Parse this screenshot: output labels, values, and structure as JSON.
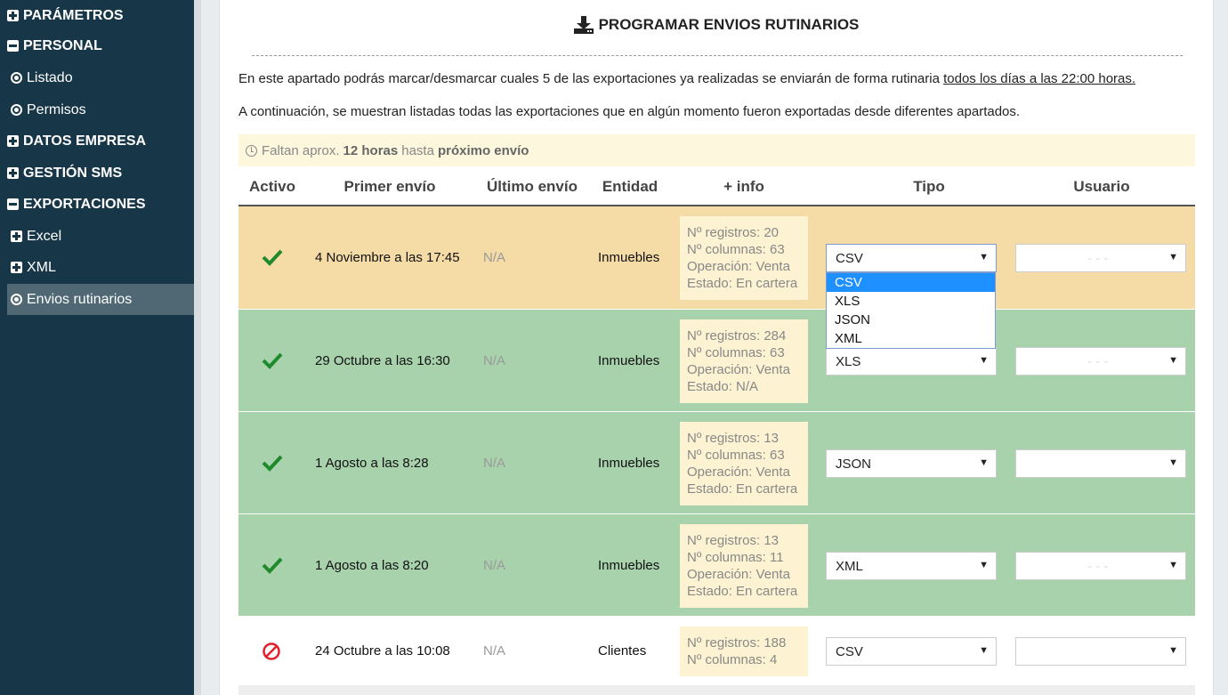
{
  "sidebar": {
    "items": [
      {
        "label": "PARÁMETROS",
        "kind": "top",
        "icon": "plus-square-icon"
      },
      {
        "label": "PERSONAL",
        "kind": "top",
        "icon": "minus-square-icon"
      },
      {
        "label": "Listado",
        "kind": "sub",
        "icon": "radio-dot-icon"
      },
      {
        "label": "Permisos",
        "kind": "sub",
        "icon": "radio-dot-icon"
      },
      {
        "label": "DATOS EMPRESA",
        "kind": "top",
        "icon": "plus-square-icon"
      },
      {
        "label": "GESTIÓN SMS",
        "kind": "top",
        "icon": "plus-square-icon"
      },
      {
        "label": "EXPORTACIONES",
        "kind": "top",
        "icon": "minus-square-icon"
      },
      {
        "label": "Excel",
        "kind": "sub",
        "icon": "plus-square-icon"
      },
      {
        "label": "XML",
        "kind": "sub",
        "icon": "plus-square-icon"
      },
      {
        "label": "Envios rutinarios",
        "kind": "sub",
        "icon": "radio-dot-icon",
        "active": true
      }
    ]
  },
  "page": {
    "title": "PROGRAMAR ENVIOS RUTINARIOS",
    "title_icon": "download-icon",
    "intro": "En este apartado podrás marcar/desmarcar cuales 5 de las exportaciones ya realizadas se enviarán de forma rutinaria",
    "intro_link": "todos los días a las 22:00 horas.",
    "intro2": "A continuación, se muestran listadas todas las exportaciones que en algún momento fueron exportadas desde diferentes apartados.",
    "notice": {
      "icon": "clock-icon",
      "prefix": "Faltan aprox.",
      "bold": "12 horas",
      "middle": "hasta",
      "bold2": "próximo envío"
    }
  },
  "table": {
    "headers": [
      "Activo",
      "Primer envío",
      "Último envío",
      "Entidad",
      "+ info",
      "Tipo",
      "Usuario"
    ],
    "rows": [
      {
        "active": true,
        "first": "4 Noviembre a las 17:45",
        "last": "N/A",
        "entity": "Inmuebles",
        "info": [
          "Nº registros: 20",
          "Nº columnas: 63",
          "Operación: Venta",
          "Estado: En cartera"
        ],
        "tipo": "CSV",
        "usuario": "- - -",
        "bg": "#f5dba6"
      },
      {
        "active": true,
        "first": "29 Octubre a las 16:30",
        "last": "N/A",
        "entity": "Inmuebles",
        "info": [
          "Nº registros: 284",
          "Nº columnas: 63",
          "Operación: Venta",
          "Estado: N/A"
        ],
        "tipo": "XLS",
        "usuario": "- - -",
        "bg": "#a8d2ac"
      },
      {
        "active": true,
        "first": "1 Agosto a las 8:28",
        "last": "N/A",
        "entity": "Inmuebles",
        "info": [
          "Nº registros: 13",
          "Nº columnas: 63",
          "Operación: Venta",
          "Estado: En cartera"
        ],
        "tipo": "JSON",
        "usuario": "",
        "bg": "#a8d2ac"
      },
      {
        "active": true,
        "first": "1 Agosto a las 8:20",
        "last": "N/A",
        "entity": "Inmuebles",
        "info": [
          "Nº registros: 13",
          "Nº columnas: 11",
          "Operación: Venta",
          "Estado: En cartera"
        ],
        "tipo": "XML",
        "usuario": "- - -",
        "bg": "#a8d2ac"
      },
      {
        "active": false,
        "first": "24 Octubre a las 10:08",
        "last": "N/A",
        "entity": "Clientes",
        "info": [
          "Nº registros: 188",
          "Nº columnas: 4"
        ],
        "tipo": "CSV",
        "usuario": "",
        "bg": "#ffffff"
      }
    ],
    "tipo_dropdown": {
      "options": [
        "CSV",
        "XLS",
        "JSON",
        "XML"
      ],
      "highlighted": "CSV"
    }
  },
  "colors": {
    "sidebar_bg": "#173748",
    "sidebar_active": "#4f6874",
    "check": "#1f8a2c",
    "forbidden": "#e0202a",
    "highlight": "#1e90ff"
  }
}
